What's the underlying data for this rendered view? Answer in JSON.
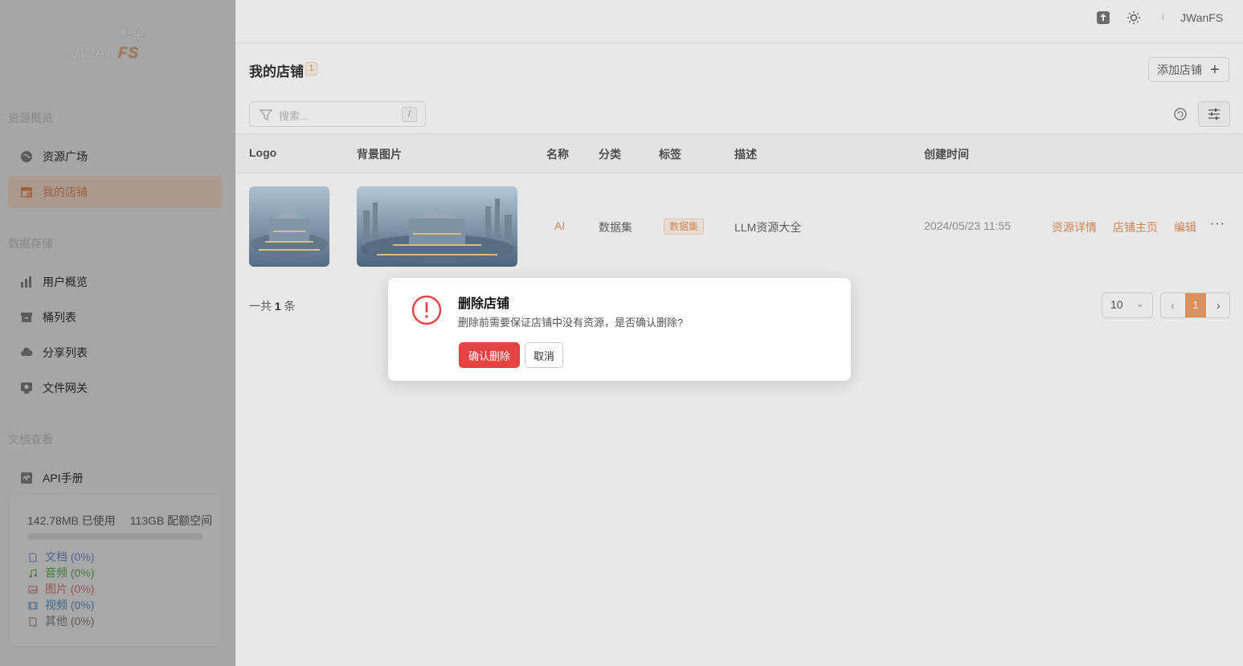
{
  "brand": {
    "logo_text_a": "JWAN",
    "logo_text_b": "FS"
  },
  "sidebar": {
    "section1": "资源概览",
    "items1": [
      {
        "label": "资源广场",
        "icon": "globe-icon"
      },
      {
        "label": "我的店铺",
        "icon": "store-icon",
        "active": true
      }
    ],
    "section2": "数据存储",
    "items2": [
      {
        "label": "用户概览",
        "icon": "bar-chart-icon"
      },
      {
        "label": "桶列表",
        "icon": "archive-icon"
      },
      {
        "label": "分享列表",
        "icon": "cloud-share-icon"
      },
      {
        "label": "文件网关",
        "icon": "gateway-icon"
      }
    ],
    "section3": "文档查看",
    "items3": [
      {
        "label": "API手册",
        "icon": "api-doc-icon"
      }
    ],
    "storage": {
      "used": "142.78MB 已使用",
      "quota": "113GB 配额空间",
      "used_fraction": 0.0012,
      "legend": [
        {
          "label": "文档 (0%)",
          "color": "#7b8ee0",
          "icon": "document-icon"
        },
        {
          "label": "音频 (0%)",
          "color": "#5cb85c",
          "icon": "music-icon"
        },
        {
          "label": "图片 (0%)",
          "color": "#e07b7b",
          "icon": "image-icon"
        },
        {
          "label": "视频 (0%)",
          "color": "#5b9bd5",
          "icon": "video-icon"
        },
        {
          "label": "其他 (0%)",
          "color": "#888888",
          "icon": "file-icon"
        }
      ]
    }
  },
  "topbar": {
    "username": "JWanFS",
    "user_initial": "i"
  },
  "page": {
    "title": "我的店铺",
    "count": "1",
    "add_button": "添加店铺",
    "search_placeholder": "搜索...",
    "search_shortcut": "/"
  },
  "table": {
    "columns": [
      "Logo",
      "背景图片",
      "名称",
      "分类",
      "标签",
      "描述",
      "创建时间"
    ],
    "rows": [
      {
        "name": "AI",
        "category": "数据集",
        "tag": "数据集",
        "description": "LLM资源大全",
        "created": "2024/05/23 11:55",
        "actions": [
          "资源详情",
          "店铺主页",
          "编辑"
        ],
        "more": "···"
      }
    ]
  },
  "pagination": {
    "total_prefix": "一共",
    "total": "1",
    "total_suffix": "条",
    "page_size": "10",
    "current_page": "1"
  },
  "dialog": {
    "title": "删除店铺",
    "message": "删除前需要保证店铺中没有资源，是否确认删除?",
    "confirm": "确认删除",
    "cancel": "取消"
  },
  "colors": {
    "accent": "#e8905a",
    "danger": "#e84343"
  }
}
